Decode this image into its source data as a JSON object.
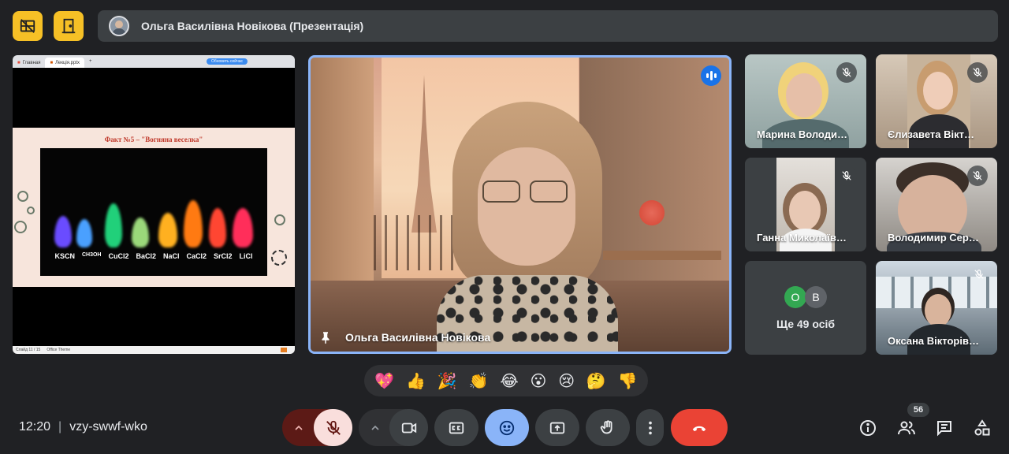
{
  "header": {
    "title": "Ольга Василівна Новікова (Презентація)",
    "layout_button_icon": "layout-off-icon",
    "door_button_icon": "door-icon"
  },
  "presentation": {
    "browser_tabs": [
      "Главная",
      "Лекція.pptx"
    ],
    "update_button": "Обновить сейчас",
    "slide_title": "Факт №5 – \"Вогняна веселка\"",
    "flame_labels": [
      "KSCN",
      "CH3OH",
      "CuCl2",
      "BaCl2",
      "NaCl",
      "CaCl2",
      "SrCl2",
      "LiCl"
    ],
    "status_slide": "Слайд 11 / 15",
    "status_theme": "Office Theme"
  },
  "speaker": {
    "name": "Ольга Василівна Новікова"
  },
  "participants": [
    {
      "name": "Марина Володи…"
    },
    {
      "name": "Єлизавета Вікт…"
    },
    {
      "name": "Ганна Миколаїв…"
    },
    {
      "name": "Володимир Сер…"
    },
    {
      "name": "Оксана Вікторів…"
    }
  ],
  "others": {
    "avatars": [
      {
        "letter": "О",
        "color": "#33a852"
      },
      {
        "letter": "В",
        "color": "#5f6368"
      }
    ],
    "label": "Ще 49 осіб"
  },
  "reactions": [
    "💖",
    "👍",
    "🎉",
    "👏",
    "😂",
    "😮",
    "😢",
    "🤔",
    "👎"
  ],
  "footer": {
    "time": "12:20",
    "separator": "|",
    "meeting_code": "vzy-swwf-wko",
    "participant_count": "56"
  },
  "colors": {
    "accent_yellow": "#f6c026",
    "mic_muted": "#f9dedc",
    "emoji_active": "#8ab4f8",
    "end_call": "#ea4335",
    "speaker_border": "#8ab4f8"
  }
}
